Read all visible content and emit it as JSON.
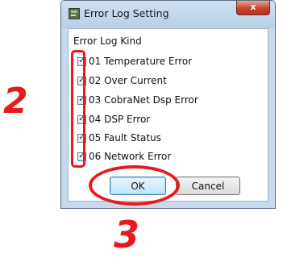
{
  "window": {
    "title": "Error Log Setting",
    "close_label": "x"
  },
  "form": {
    "group_label": "Error Log Kind",
    "items": [
      {
        "label": "01 Temperature Error",
        "checked": true
      },
      {
        "label": "02 Over Current",
        "checked": true
      },
      {
        "label": "03 CobraNet Dsp Error",
        "checked": true
      },
      {
        "label": "04 DSP Error",
        "checked": true
      },
      {
        "label": "05 Fault Status",
        "checked": true
      },
      {
        "label": "06 Network Error",
        "checked": true
      }
    ],
    "ok_label": "OK",
    "cancel_label": "Cancel"
  },
  "annotations": {
    "step_checkboxes": "2",
    "step_ok": "3",
    "color": "#e8191f"
  }
}
